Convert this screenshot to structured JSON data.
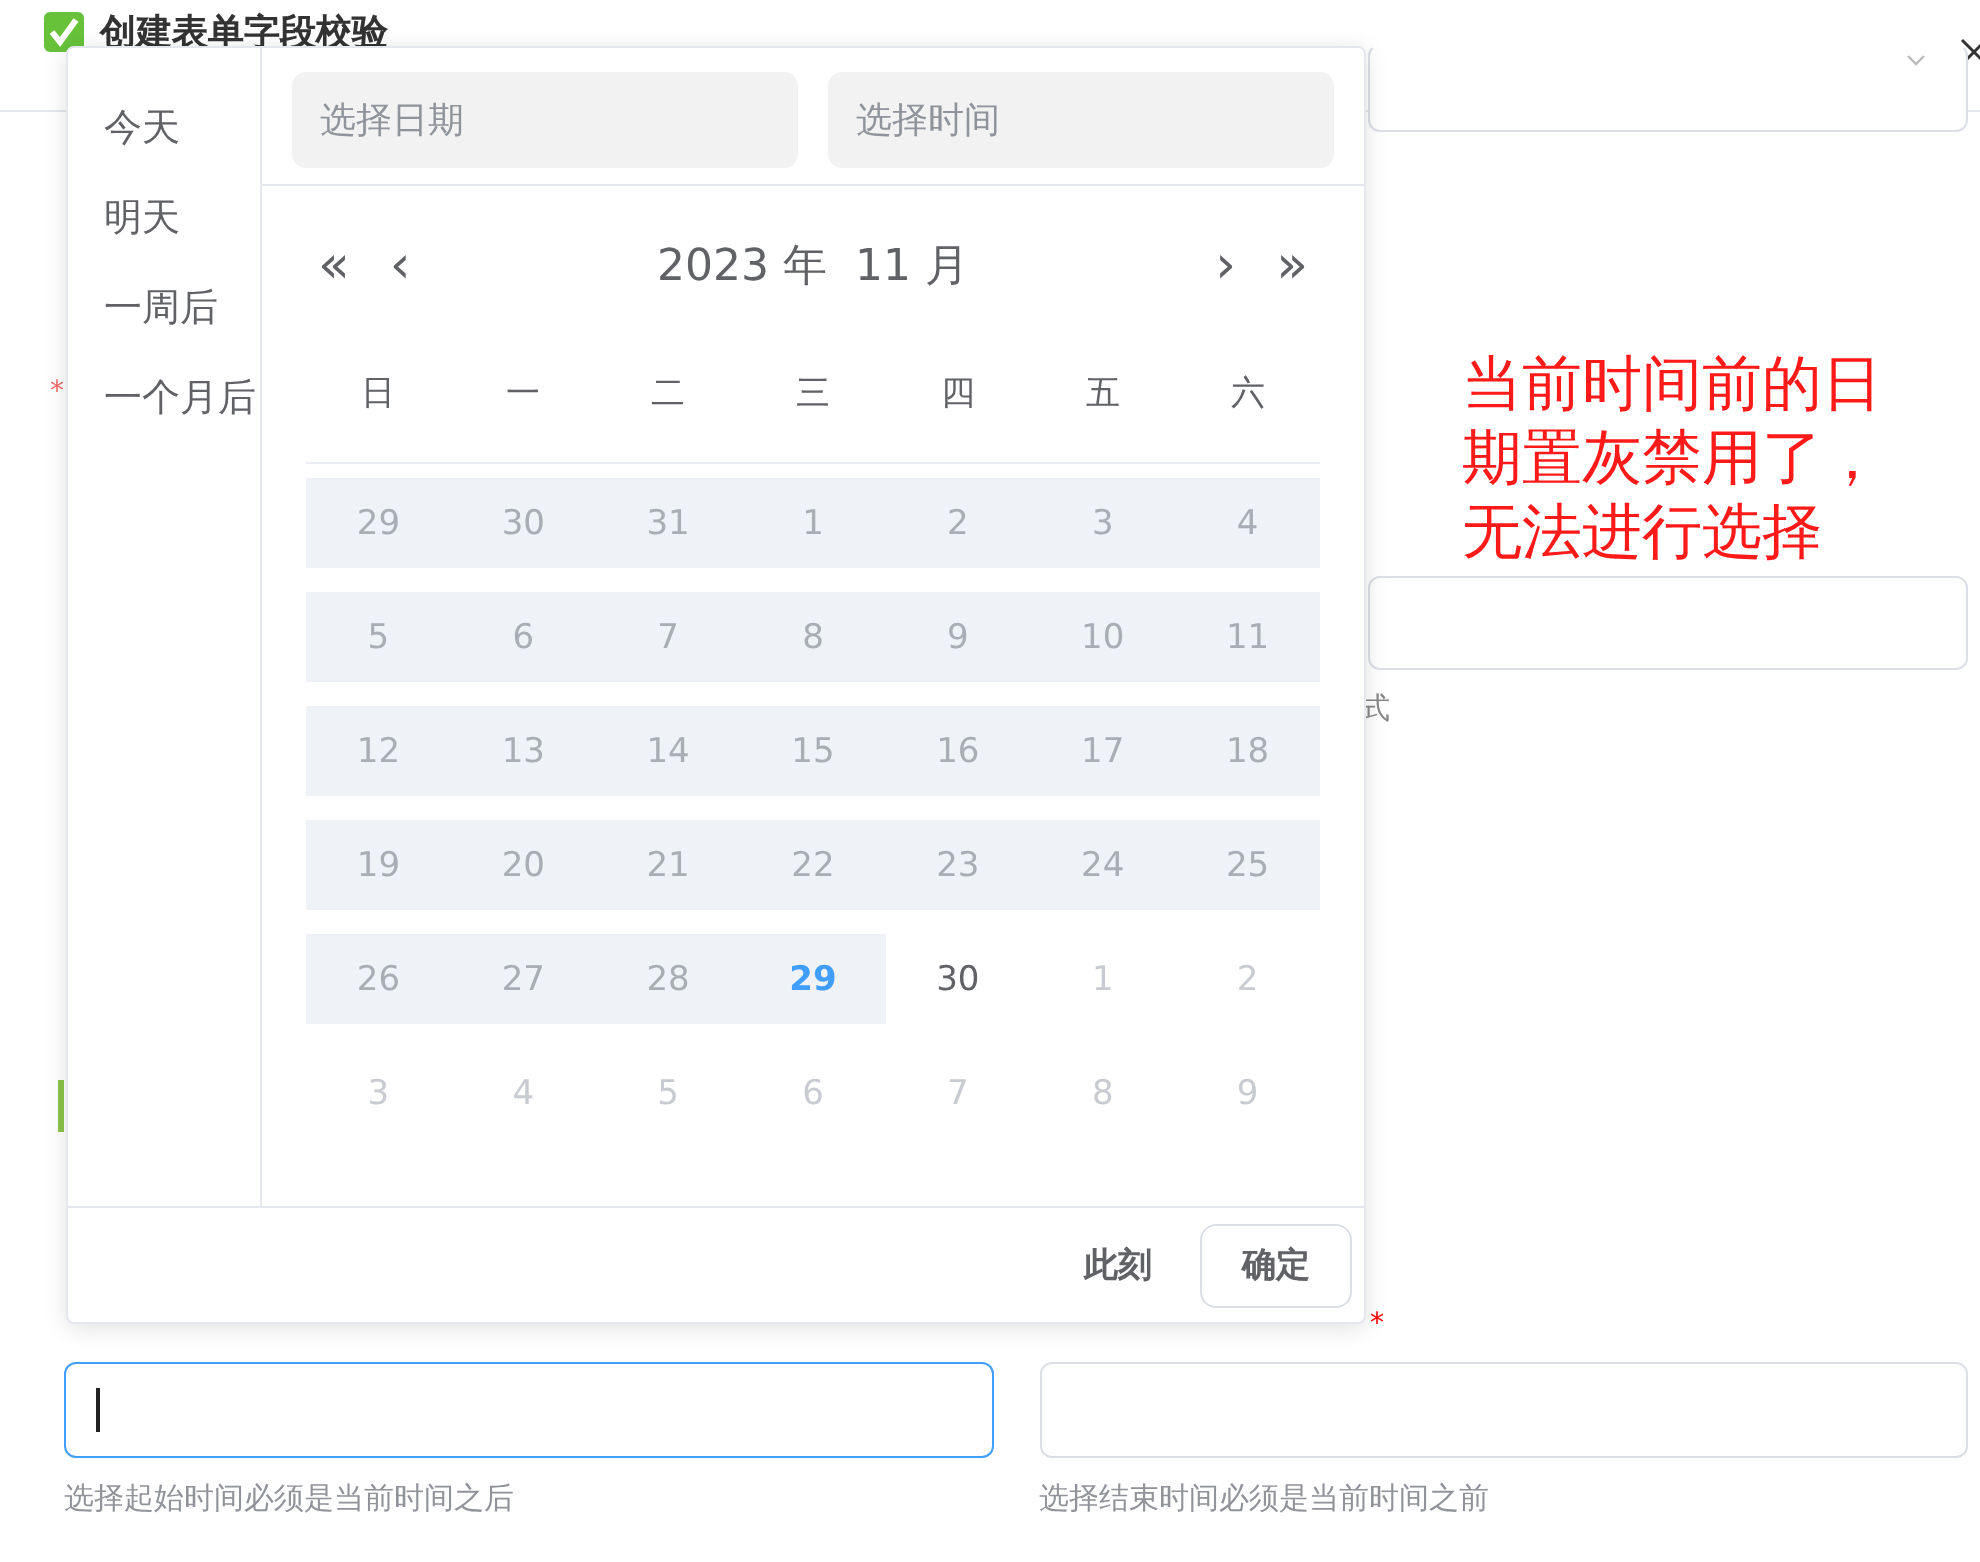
{
  "dialog": {
    "title": "创建表单字段校验",
    "checked": true
  },
  "form": {
    "required_mark_left": "*",
    "hint_fragment": "式",
    "required_mark_right": "*",
    "start_field": {
      "focused": true,
      "hint": "选择起始时间必须是当前时间之后"
    },
    "end_field": {
      "focused": false,
      "hint": "选择结束时间必须是当前时间之前"
    }
  },
  "picker": {
    "shortcuts": [
      "今天",
      "明天",
      "一周后",
      "一个月后"
    ],
    "date_input": {
      "placeholder": "选择日期"
    },
    "time_input": {
      "placeholder": "选择时间"
    },
    "nav": {
      "prev_year": "«",
      "prev_month": "‹",
      "year": "2023 年",
      "month": "11 月",
      "next_month": "›",
      "next_year": "»"
    },
    "weekdays": [
      "日",
      "一",
      "二",
      "三",
      "四",
      "五",
      "六"
    ],
    "days": [
      {
        "label": "29",
        "kind": "prev",
        "disabled": true,
        "today": false
      },
      {
        "label": "30",
        "kind": "prev",
        "disabled": true,
        "today": false
      },
      {
        "label": "31",
        "kind": "prev",
        "disabled": true,
        "today": false
      },
      {
        "label": "1",
        "kind": "current",
        "disabled": true,
        "today": false
      },
      {
        "label": "2",
        "kind": "current",
        "disabled": true,
        "today": false
      },
      {
        "label": "3",
        "kind": "current",
        "disabled": true,
        "today": false
      },
      {
        "label": "4",
        "kind": "current",
        "disabled": true,
        "today": false
      },
      {
        "label": "5",
        "kind": "current",
        "disabled": true,
        "today": false
      },
      {
        "label": "6",
        "kind": "current",
        "disabled": true,
        "today": false
      },
      {
        "label": "7",
        "kind": "current",
        "disabled": true,
        "today": false
      },
      {
        "label": "8",
        "kind": "current",
        "disabled": true,
        "today": false
      },
      {
        "label": "9",
        "kind": "current",
        "disabled": true,
        "today": false
      },
      {
        "label": "10",
        "kind": "current",
        "disabled": true,
        "today": false
      },
      {
        "label": "11",
        "kind": "current",
        "disabled": true,
        "today": false
      },
      {
        "label": "12",
        "kind": "current",
        "disabled": true,
        "today": false
      },
      {
        "label": "13",
        "kind": "current",
        "disabled": true,
        "today": false
      },
      {
        "label": "14",
        "kind": "current",
        "disabled": true,
        "today": false
      },
      {
        "label": "15",
        "kind": "current",
        "disabled": true,
        "today": false
      },
      {
        "label": "16",
        "kind": "current",
        "disabled": true,
        "today": false
      },
      {
        "label": "17",
        "kind": "current",
        "disabled": true,
        "today": false
      },
      {
        "label": "18",
        "kind": "current",
        "disabled": true,
        "today": false
      },
      {
        "label": "19",
        "kind": "current",
        "disabled": true,
        "today": false
      },
      {
        "label": "20",
        "kind": "current",
        "disabled": true,
        "today": false
      },
      {
        "label": "21",
        "kind": "current",
        "disabled": true,
        "today": false
      },
      {
        "label": "22",
        "kind": "current",
        "disabled": true,
        "today": false
      },
      {
        "label": "23",
        "kind": "current",
        "disabled": true,
        "today": false
      },
      {
        "label": "24",
        "kind": "current",
        "disabled": true,
        "today": false
      },
      {
        "label": "25",
        "kind": "current",
        "disabled": true,
        "today": false
      },
      {
        "label": "26",
        "kind": "current",
        "disabled": true,
        "today": false
      },
      {
        "label": "27",
        "kind": "current",
        "disabled": true,
        "today": false
      },
      {
        "label": "28",
        "kind": "current",
        "disabled": true,
        "today": false
      },
      {
        "label": "29",
        "kind": "current",
        "disabled": true,
        "today": true
      },
      {
        "label": "30",
        "kind": "current",
        "disabled": false,
        "today": false
      },
      {
        "label": "1",
        "kind": "next",
        "disabled": false,
        "today": false
      },
      {
        "label": "2",
        "kind": "next",
        "disabled": false,
        "today": false
      },
      {
        "label": "3",
        "kind": "next",
        "disabled": false,
        "today": false
      },
      {
        "label": "4",
        "kind": "next",
        "disabled": false,
        "today": false
      },
      {
        "label": "5",
        "kind": "next",
        "disabled": false,
        "today": false
      },
      {
        "label": "6",
        "kind": "next",
        "disabled": false,
        "today": false
      },
      {
        "label": "7",
        "kind": "next",
        "disabled": false,
        "today": false
      },
      {
        "label": "8",
        "kind": "next",
        "disabled": false,
        "today": false
      },
      {
        "label": "9",
        "kind": "next",
        "disabled": false,
        "today": false
      }
    ],
    "footer": {
      "now_button": "此刻",
      "confirm_button": "确定"
    }
  },
  "annotation": {
    "text": "当前时间前的日期置灰禁用了，无法进行选择"
  }
}
